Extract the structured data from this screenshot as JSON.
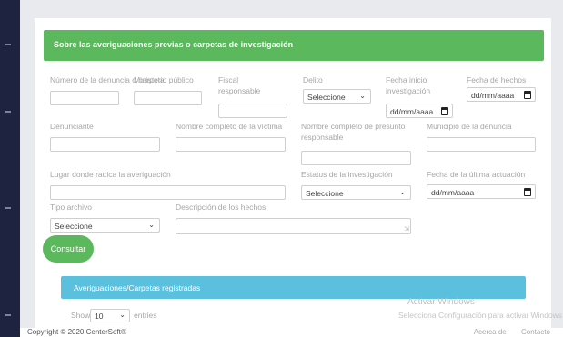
{
  "card": {
    "title": "Sobre las averiguaciones previas o carpetas de investigación"
  },
  "form": {
    "row1": {
      "numero_label": "Número de la denuncia o carpeta",
      "ministerio_label": "Ministerio público",
      "fiscal_label": "Fiscal responsable",
      "delito_label": "Delito",
      "delito_value": "Seleccione",
      "fecha_inicio_label": "Fecha inicio investigación",
      "fecha_inicio_value": "dd/mm/aaaa",
      "fecha_hechos_label": "Fecha de hechos",
      "fecha_hechos_value": "dd/mm/aaaa"
    },
    "row2": {
      "denunciante_label": "Denunciante",
      "victima_label": "Nombre completo de la víctima",
      "presunto_label": "Nombre completo de presunto responsable",
      "municipio_label": "Municipio de la denuncia"
    },
    "row3": {
      "lugar_label": "Lugar donde radica la averiguación",
      "estatus_label": "Estatus de la investigación",
      "estatus_value": "Seleccione",
      "fecha_ultima_label": "Fecha de la última actuación",
      "fecha_ultima_value": "dd/mm/aaaa"
    },
    "row4": {
      "tipo_label": "Tipo archivo",
      "tipo_value": "Seleccione",
      "descripcion_label": "Descripción de los hechos"
    },
    "search_button": "Consultar"
  },
  "registered": {
    "title": "Averiguaciones/Carpetas registradas"
  },
  "table_controls": {
    "show_label": "Show",
    "show_value": "10",
    "entries_label": "entries"
  },
  "watermark": {
    "line1": "Activar Windows",
    "line2": "Selecciona Configuración para activar Windows"
  },
  "footer": {
    "copyright": "Copyright © 2020 CenterSoft®",
    "link1": "Acerca de",
    "link2": "Contacto"
  }
}
